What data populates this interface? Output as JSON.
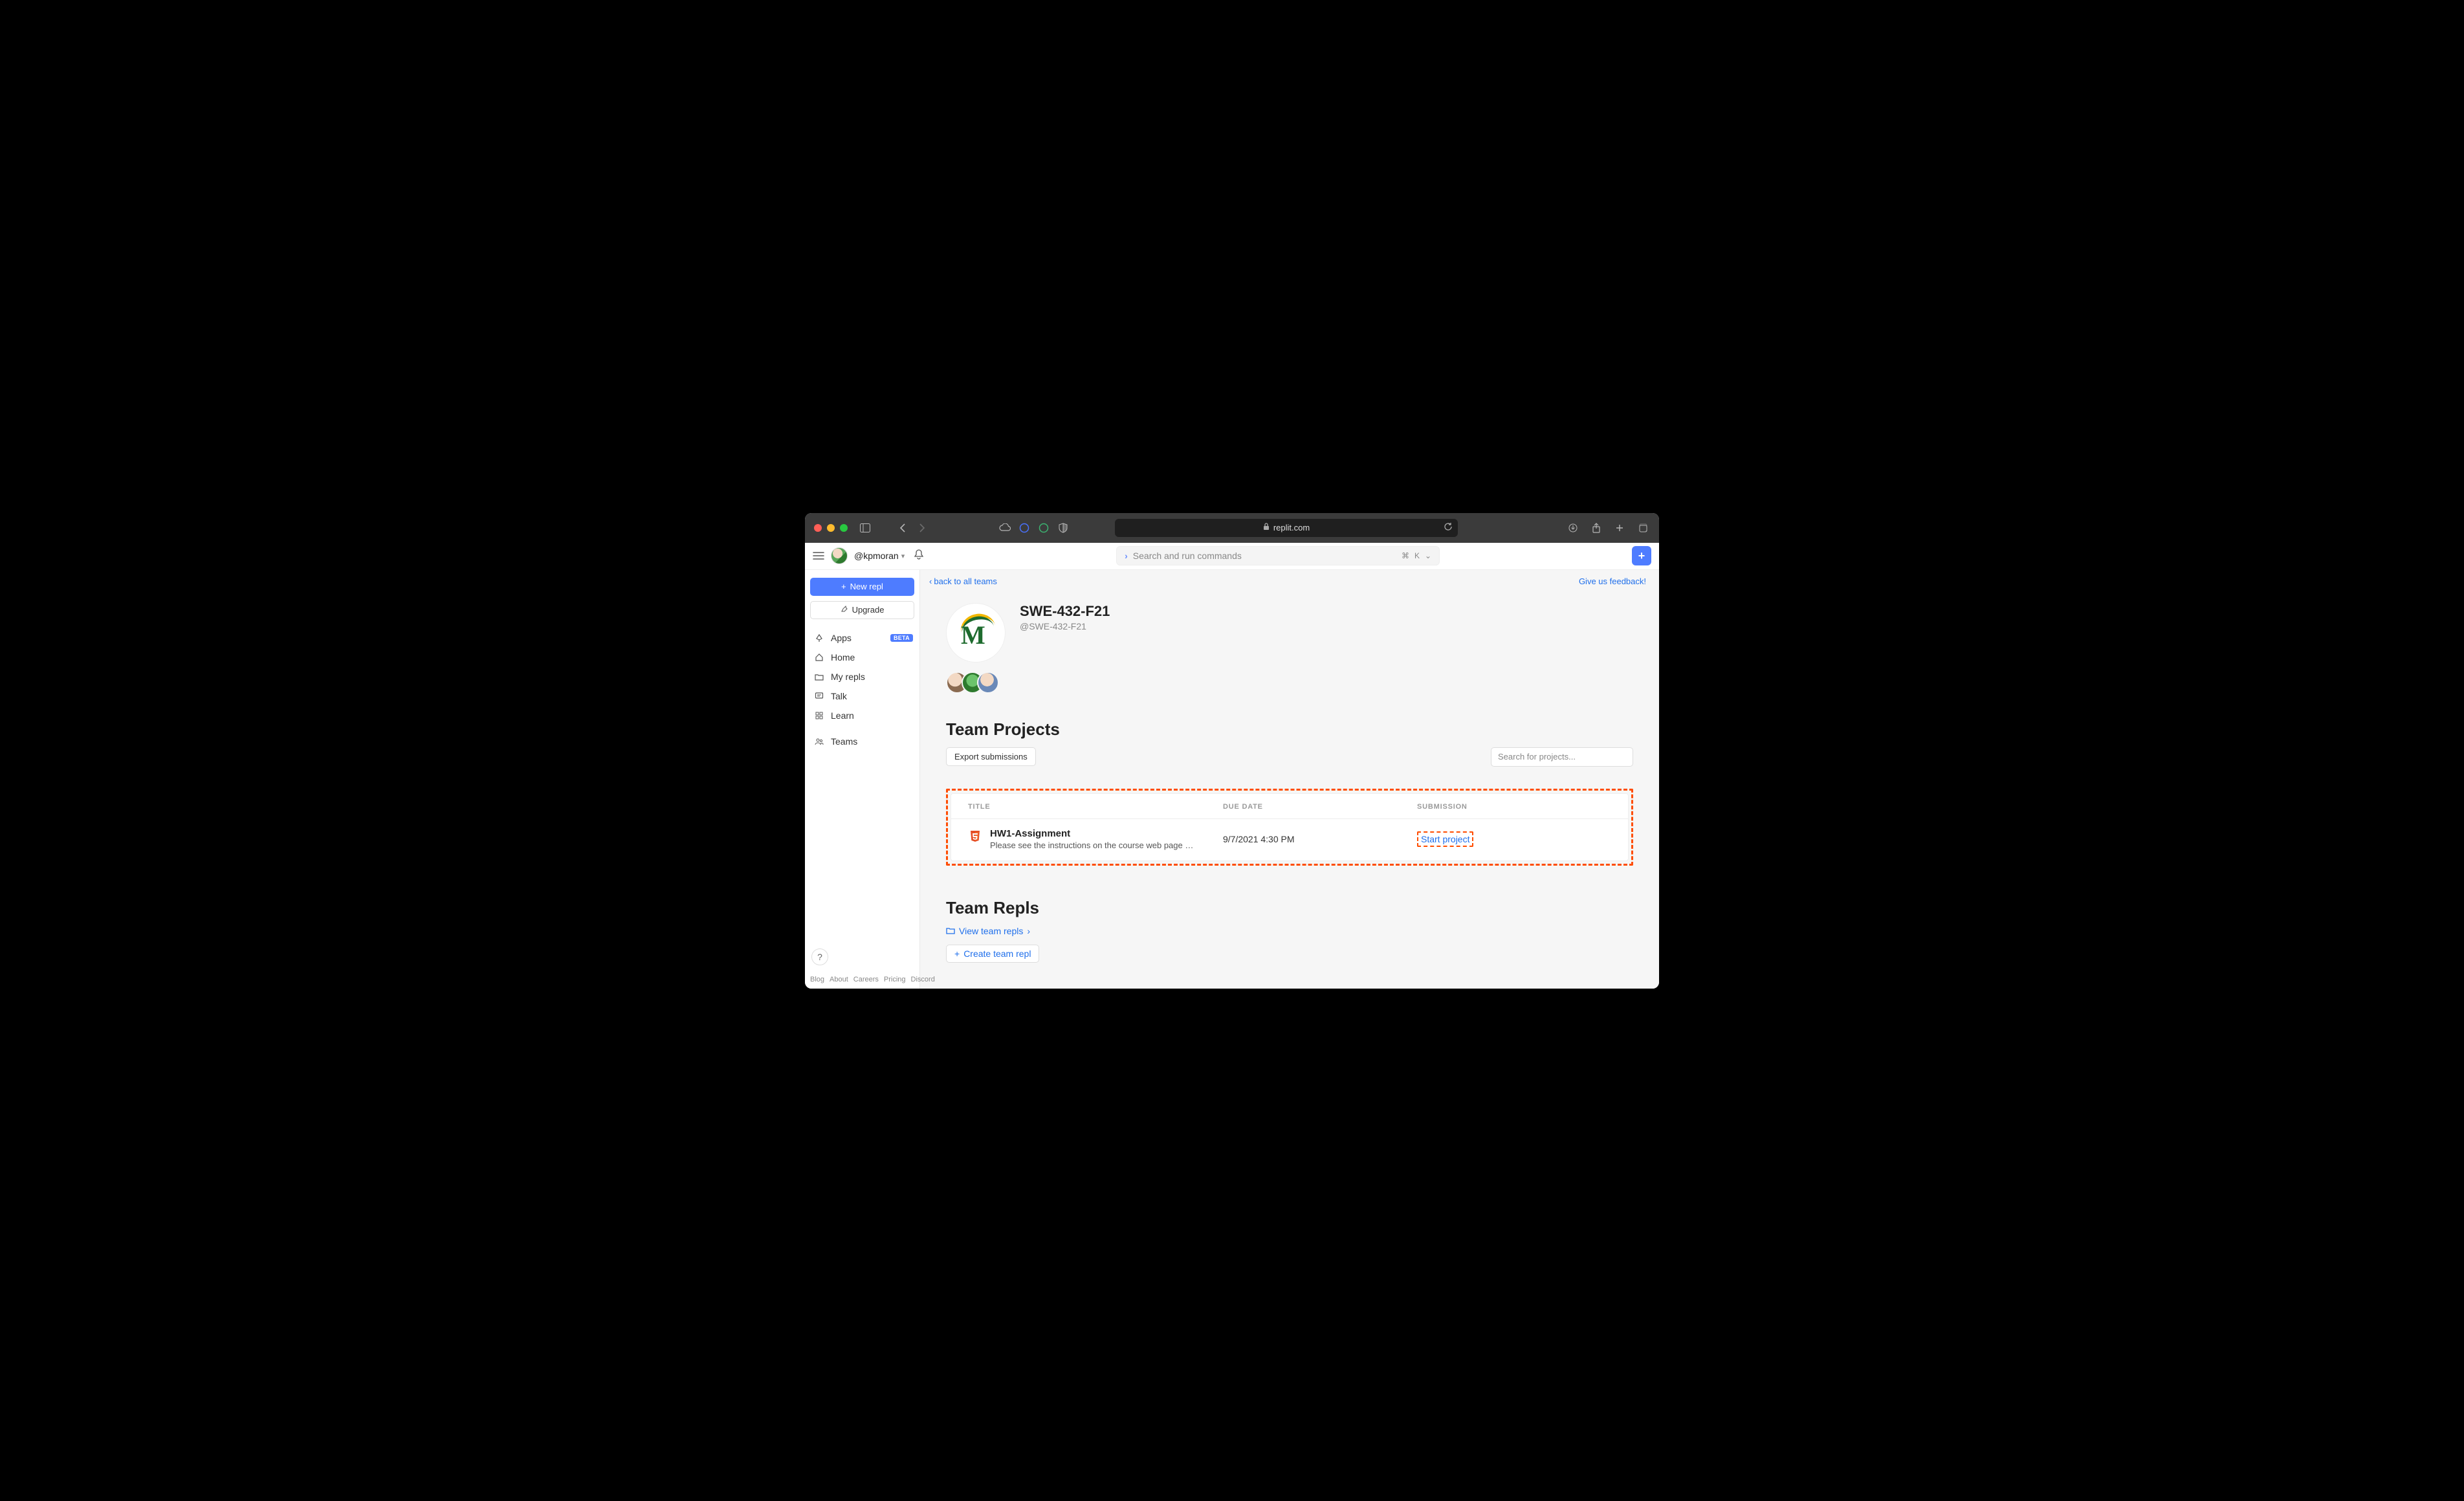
{
  "browser": {
    "url_host": "replit.com"
  },
  "header": {
    "username": "@kpmoran",
    "search_placeholder": "Search and run commands",
    "cmd_key": "⌘",
    "k_key": "K"
  },
  "sidebar": {
    "new_repl": "New repl",
    "upgrade": "Upgrade",
    "items": [
      {
        "label": "Apps",
        "badge": "BETA"
      },
      {
        "label": "Home"
      },
      {
        "label": "My repls"
      },
      {
        "label": "Talk"
      },
      {
        "label": "Learn"
      },
      {
        "label": "Teams"
      }
    ],
    "help": "?",
    "footer": [
      "Blog",
      "About",
      "Careers",
      "Pricing",
      "Discord"
    ]
  },
  "breadcrumbs": {
    "back": "back to all teams",
    "feedback": "Give us feedback!"
  },
  "team": {
    "name": "SWE-432-F21",
    "handle": "@SWE-432-F21"
  },
  "projects": {
    "heading": "Team Projects",
    "export_btn": "Export submissions",
    "search_placeholder": "Search for projects...",
    "columns": {
      "title": "TITLE",
      "due": "DUE DATE",
      "submission": "SUBMISSION"
    },
    "rows": [
      {
        "title": "HW1-Assignment",
        "desc": "Please see the instructions on the course web page at https://cs.gm...",
        "due": "9/7/2021 4:30 PM",
        "action": "Start project"
      }
    ]
  },
  "repls": {
    "heading": "Team Repls",
    "view_link": "View team repls",
    "create_btn": "Create team repl"
  }
}
